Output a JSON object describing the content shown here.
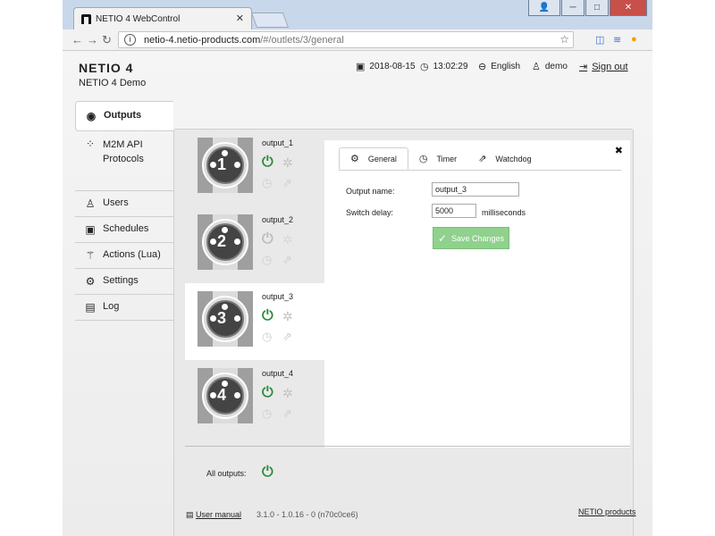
{
  "browser": {
    "tab_title": "NETIO 4 WebControl",
    "url_host": "netio-4.netio-products.com",
    "url_path": "/#/outlets/3/general"
  },
  "app": {
    "brand": "NETIO 4",
    "device_name": "NETIO 4 Demo",
    "date": "2018-08-15",
    "time": "13:02:29",
    "language": "English",
    "user": "demo",
    "sign_out": "Sign out"
  },
  "sidebar": {
    "items": [
      {
        "label": "Outputs",
        "icon": "outputs-icon"
      },
      {
        "label": "M2M API Protocols",
        "icon": "m2m-icon"
      },
      {
        "label": "Users",
        "icon": "user-icon"
      },
      {
        "label": "Schedules",
        "icon": "calendar-icon"
      },
      {
        "label": "Actions (Lua)",
        "icon": "wand-icon"
      },
      {
        "label": "Settings",
        "icon": "gear-icon"
      },
      {
        "label": "Log",
        "icon": "document-icon"
      }
    ]
  },
  "outputs": [
    {
      "name": "output_1",
      "number": "1",
      "state": "on"
    },
    {
      "name": "output_2",
      "number": "2",
      "state": "off"
    },
    {
      "name": "output_3",
      "number": "3",
      "state": "on"
    },
    {
      "name": "output_4",
      "number": "4",
      "state": "on"
    }
  ],
  "detail": {
    "tabs": [
      "General",
      "Timer",
      "Watchdog"
    ],
    "output_name_label": "Output name:",
    "output_name_value": "output_3",
    "switch_delay_label": "Switch delay:",
    "switch_delay_value": "5000",
    "switch_delay_unit": "milliseconds",
    "save_label": "Save Changes"
  },
  "all_outputs_label": "All outputs:",
  "footer": {
    "manual": "User manual",
    "version": "3.1.0 - 1.0.16 - 0 (n70c0ce6)",
    "vendor": "NETIO products"
  },
  "colors": {
    "power_on": "#2e8b3d",
    "save_button": "#8fd18d",
    "close_button": "#c7504a"
  }
}
